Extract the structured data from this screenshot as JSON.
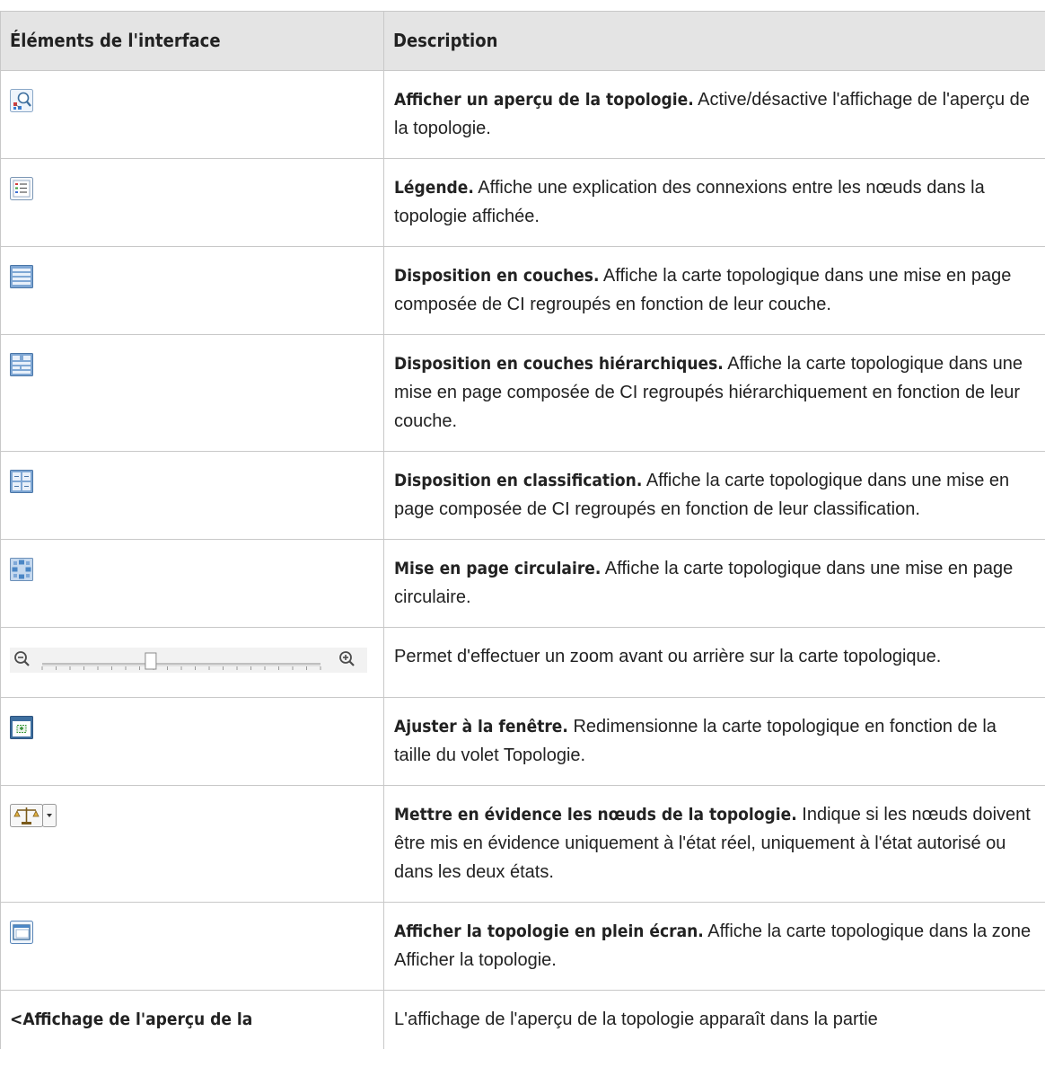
{
  "header": {
    "col_element": "Éléments de l'interface",
    "col_description": "Description"
  },
  "rows": [
    {
      "icon": "topology-preview-icon",
      "term": "Afficher un aperçu de la topologie.",
      "text": " Active/désactive l'affichage de l'aperçu de la topologie."
    },
    {
      "icon": "legend-icon",
      "term": "Légende.",
      "text": " Affiche une explication des connexions entre les nœuds dans la topologie affichée."
    },
    {
      "icon": "layer-layout-icon",
      "term": "Disposition en couches.",
      "text": " Affiche la carte topologique dans une mise en page composée de CI regroupés en fonction de leur couche."
    },
    {
      "icon": "hierarchical-layer-layout-icon",
      "term": "Disposition en couches hiérarchiques.",
      "text": " Affiche la carte topologique dans une mise en page composée de CI regroupés hiérarchiquement en fonction de leur couche."
    },
    {
      "icon": "classification-layout-icon",
      "term": "Disposition en classification.",
      "text": " Affiche la carte topologique dans une mise en page composée de CI regroupés en fonction de leur classification."
    },
    {
      "icon": "circular-layout-icon",
      "term": "Mise en page circulaire.",
      "text": " Affiche la carte topologique dans une mise en page circulaire."
    },
    {
      "icon": "zoom-slider",
      "term": "",
      "text": "Permet d'effectuer un zoom avant ou arrière sur la carte topologique."
    },
    {
      "icon": "fit-to-window-icon",
      "term": "Ajuster à la fenêtre.",
      "text": " Redimensionne la carte topologique en fonction de la taille du volet Topologie."
    },
    {
      "icon": "highlight-nodes-icon",
      "term": "Mettre en évidence les nœuds de la topologie.",
      "text": " Indique si les nœuds doivent être mis en évidence uniquement à l'état réel, uniquement à l'état autorisé ou dans les deux états."
    },
    {
      "icon": "fullscreen-icon",
      "term": "Afficher la topologie en plein écran.",
      "text": " Affiche la carte topologique dans la zone Afficher la topologie."
    },
    {
      "element_text": "<Affichage de l'aperçu de la",
      "term": "",
      "text": "L'affichage de l'aperçu de la topologie apparaît dans la partie"
    }
  ],
  "zoom_slider": {
    "level": 0.39
  },
  "colors": {
    "header_bg": "#e4e4e4",
    "border": "#c8c8c8",
    "icon_blue": "#4a86c5"
  }
}
